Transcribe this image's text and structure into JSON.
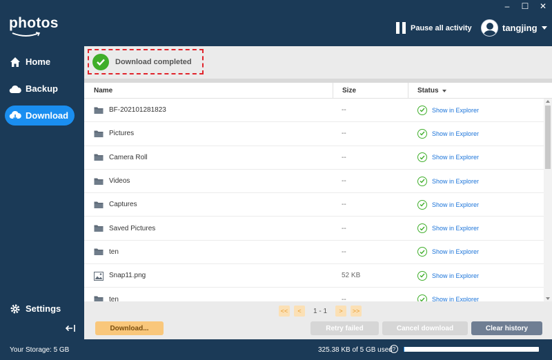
{
  "app": {
    "logo_text": "photos"
  },
  "window": {
    "minimize": "–",
    "maximize": "☐",
    "close": "✕"
  },
  "header": {
    "pause_label": "Pause all activity",
    "username": "tangjing"
  },
  "sidebar": {
    "items": [
      {
        "label": "Home",
        "icon": "home-icon"
      },
      {
        "label": "Backup",
        "icon": "cloud-icon"
      },
      {
        "label": "Download",
        "icon": "cloud-download-icon",
        "active": true
      }
    ],
    "settings_label": "Settings"
  },
  "banner": {
    "text": "Download completed"
  },
  "table": {
    "columns": {
      "name": "Name",
      "size": "Size",
      "status": "Status"
    },
    "rows": [
      {
        "name": "BF-202101281823",
        "size": "--",
        "status": "Show in Explorer",
        "type": "folder"
      },
      {
        "name": "Pictures",
        "size": "--",
        "status": "Show in Explorer",
        "type": "folder"
      },
      {
        "name": "Camera Roll",
        "size": "--",
        "status": "Show in Explorer",
        "type": "folder"
      },
      {
        "name": "Videos",
        "size": "--",
        "status": "Show in Explorer",
        "type": "folder"
      },
      {
        "name": "Captures",
        "size": "--",
        "status": "Show in Explorer",
        "type": "folder"
      },
      {
        "name": "Saved Pictures",
        "size": "--",
        "status": "Show in Explorer",
        "type": "folder"
      },
      {
        "name": "ten",
        "size": "--",
        "status": "Show in Explorer",
        "type": "folder"
      },
      {
        "name": "Snap11.png",
        "size": "52 KB",
        "status": "Show in Explorer",
        "type": "image"
      },
      {
        "name": "ten",
        "size": "--",
        "status": "Show in Explorer",
        "type": "folder"
      }
    ]
  },
  "pager": {
    "first": "<<",
    "prev": "<",
    "page_text": "1 - 1",
    "next": ">",
    "last": ">>"
  },
  "actions": {
    "download": "Download...",
    "retry": "Retry failed",
    "cancel": "Cancel download",
    "clear": "Clear history"
  },
  "footer": {
    "storage_label": "Your Storage: 5 GB",
    "usage_text": "325.38 KB of 5 GB used",
    "help": "?",
    "usage_fraction": 0.0001
  },
  "colors": {
    "accent": "#1a8ef0",
    "navy": "#1b3a57",
    "success": "#3fae2a",
    "highlight": "#e0232b"
  }
}
